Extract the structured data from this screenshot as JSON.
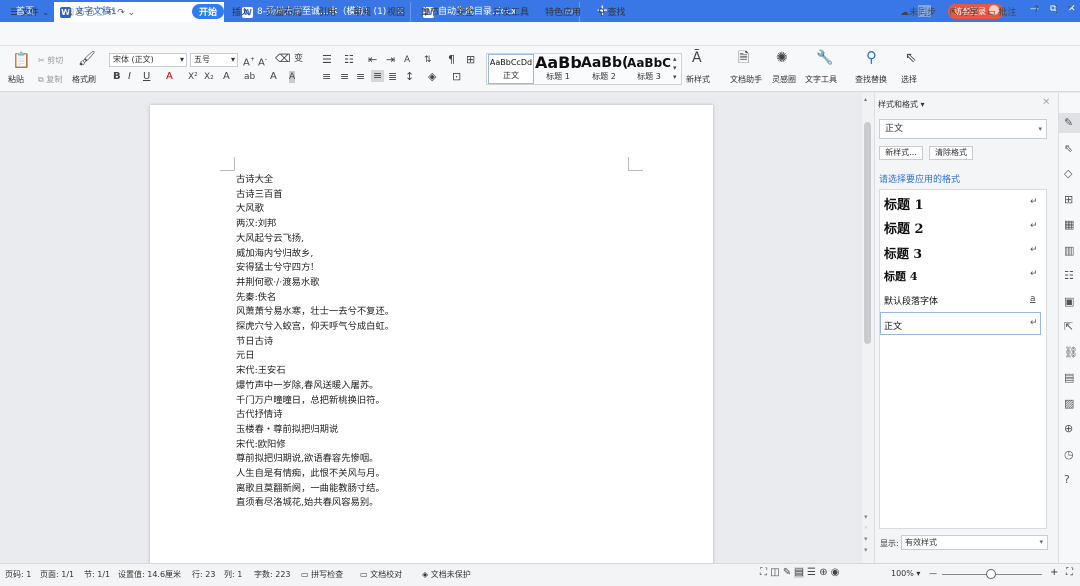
{
  "titlebar": {
    "tabs": [
      {
        "label": "首页",
        "icon": ""
      },
      {
        "label": "文字文稿1",
        "icon": "W"
      },
      {
        "label": "8-扬州大学至诚...本（模拟）(1)",
        "icon": "W"
      },
      {
        "label": "自动生成目录.docx",
        "icon": "W"
      }
    ],
    "add_tab": "+",
    "page_badge": "3",
    "login_label": "访客登录",
    "min": "—",
    "restore": "⧉",
    "close": "✕"
  },
  "menubar": {
    "file": "文件",
    "items": [
      "开始",
      "插入",
      "页面布局",
      "引用",
      "审阅",
      "视图",
      "章节",
      "安全",
      "开发工具",
      "特色应用"
    ],
    "search": "查找",
    "right": [
      "未同步",
      "分享",
      "批注"
    ],
    "help": "?"
  },
  "ribbon": {
    "paste": "粘贴",
    "cut": "剪切",
    "copy": "复制",
    "format_painter": "格式刷",
    "font_name": "宋体 (正文)",
    "font_size": "五号",
    "styles": [
      {
        "preview": "AaBbCcDd",
        "name": "正文"
      },
      {
        "preview": "AaBb",
        "name": "标题 1"
      },
      {
        "preview": "AaBb(",
        "name": "标题 2"
      },
      {
        "preview": "AaBbC",
        "name": "标题 3"
      }
    ],
    "new_style": "新样式",
    "doc_assistant": "文档助手",
    "inspiration": "灵感圈",
    "text_tools": "文字工具",
    "find_replace": "查找替换",
    "select": "选择"
  },
  "document": {
    "lines": [
      "古诗大全",
      "古诗三百首",
      "大风歌",
      "两汉:刘邦",
      "大风起兮云飞扬,",
      "威加海内兮归故乡,",
      "安得猛士兮守四方!",
      "井荆何歌·/·渡易水歌",
      "先秦:佚名",
      "风萧萧兮易水寒，壮士一去兮不复还。",
      "探虎穴兮入蛟宫，仰天呼气兮成白虹。",
      "节日古诗",
      "元日",
      "宋代:王安石",
      "爆竹声中一岁除,春风送暖入屠苏。",
      "千门万户曈曈日，总把新桃换旧符。",
      "古代抒情诗",
      "玉楼春・尊前拟把归期说",
      "宋代:欧阳修",
      "尊前拟把归期说,欲语春容先惨咽。",
      "人生自是有情痴，此恨不关风与月。",
      "离歌且莫翻新阕，一曲能教肠寸结。",
      "直须看尽洛城花,始共春风容易别。"
    ]
  },
  "panel": {
    "title": "样式和格式",
    "current_style": "正文",
    "new_style_btn": "新样式...",
    "clear_format_btn": "清除格式",
    "apply_label": "请选择要应用的格式",
    "styles": [
      "标题 1",
      "标题 2",
      "标题 3",
      "标题 4",
      "默认段落字体",
      "正文"
    ],
    "show_label": "显示:",
    "show_value": "有效样式"
  },
  "statusbar": {
    "page_code": "页码: 1",
    "pages": "页面: 1/1",
    "section": "节: 1/1",
    "setting": "设置值: 14.6厘米",
    "row": "行: 23",
    "col": "列: 1",
    "words": "字数: 223",
    "spell": "拼写检查",
    "proof": "文档校对",
    "protect": "文档未保护",
    "zoom": "100%",
    "zoom_minus": "—",
    "zoom_plus": "+"
  },
  "colors": {
    "accent": "#3a77e6",
    "start_btn": "#2e7cf6",
    "login": "#e8573f"
  }
}
